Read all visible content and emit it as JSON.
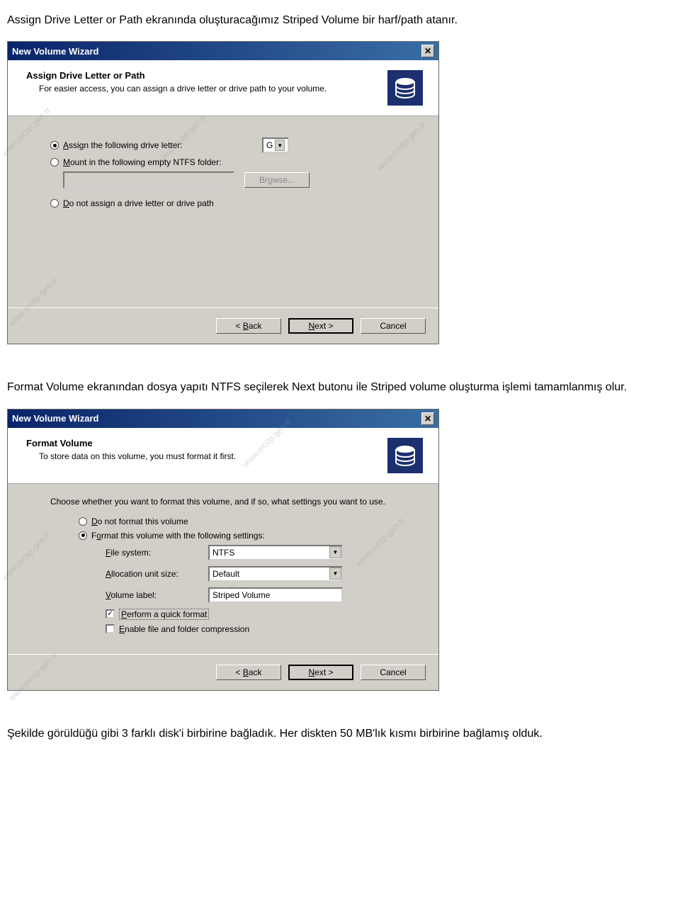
{
  "doc": {
    "para1": "Assign Drive Letter or Path ekranında oluşturacağımız Striped  Volume bir harf/path atanır.",
    "para2": "Format Volume ekranından dosya yapıtı NTFS seçilerek Next butonu ile Striped volume oluşturma işlemi tamamlanmış olur.",
    "para3": "Şekilde görüldüğü gibi 3 farklı disk'i birbirine bağladık. Her diskten 50 MB'lık kısmı birbirine bağlamış olduk."
  },
  "wizard1": {
    "title": "New Volume Wizard",
    "header_title": "Assign Drive Letter or Path",
    "header_sub": "For easier access, you can assign a drive letter or drive path to your volume.",
    "opt_assign_pre": "A",
    "opt_assign_post": "ssign the following drive letter:",
    "drive_letter": "G",
    "opt_mount_pre": "M",
    "opt_mount_post": "ount in the following empty NTFS folder:",
    "browse_pre": "Br",
    "browse_u": "o",
    "browse_post": "wse...",
    "opt_donot_pre": "D",
    "opt_donot_post": "o not assign a drive letter or drive path",
    "back": "< Back",
    "next": "Next >",
    "cancel": "Cancel"
  },
  "wizard2": {
    "title": "New Volume Wizard",
    "header_title": "Format Volume",
    "header_sub": "To store data on this volume, you must format it first.",
    "instruct": "Choose whether you want to format this volume, and if so, what settings you want to use.",
    "opt_noformat_pre": "D",
    "opt_noformat_post": "o not format this volume",
    "opt_format_pre": "F",
    "opt_format_u": "o",
    "opt_format_post": "rmat this volume with the following settings:",
    "fs_label_pre": "F",
    "fs_label_u": "i",
    "fs_label_post": "le system:",
    "fs_value": "NTFS",
    "au_label_pre": "A",
    "au_label_post": "llocation unit size:",
    "au_value": "Default",
    "vl_label_pre": "V",
    "vl_label_post": "olume label:",
    "vl_value": "Striped Volume",
    "chk_quick_pre": "P",
    "chk_quick_post": "erform a quick format",
    "chk_compress_pre": "E",
    "chk_compress_post": "nable file and folder compression",
    "back": "< Back",
    "next": "Next >",
    "cancel": "Cancel"
  },
  "watermark": "www.mcitp.gen.tr"
}
